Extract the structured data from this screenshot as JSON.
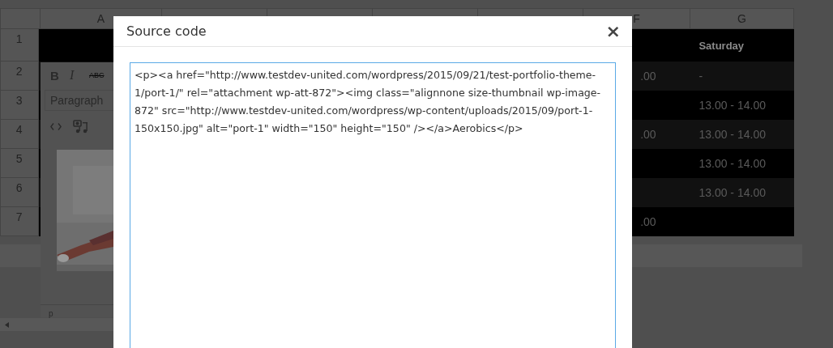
{
  "spreadsheet": {
    "column_headers": [
      "A",
      "F",
      "G"
    ],
    "row_numbers": [
      "1",
      "2",
      "3",
      "4",
      "5",
      "6",
      "7"
    ],
    "rows": [
      {
        "g": "Saturday",
        "kind": "header"
      },
      {
        "f": ".00",
        "g": "-",
        "kind": "data"
      },
      {
        "g": "13.00 - 14.00",
        "kind": "data"
      },
      {
        "f": ".00",
        "g": "13.00 - 14.00",
        "kind": "data"
      },
      {
        "g": "13.00 - 14.00",
        "kind": "data"
      },
      {
        "g": "13.00 - 14.00",
        "kind": "data"
      },
      {
        "f": ".00",
        "kind": "data"
      }
    ]
  },
  "editor": {
    "toolbar": [
      "B",
      "I",
      "ABC"
    ],
    "format_select": "Paragraph",
    "status_path": "p"
  },
  "dialog": {
    "title": "Source code",
    "close": "×",
    "code": "<p><a href=\"http://www.testdev-united.com/wordpress/2015/09/21/test-portfolio-theme-1/port-1/\" rel=\"attachment wp-att-872\"><img class=\"alignnone size-thumbnail wp-image-872\" src=\"http://www.testdev-united.com/wordpress/wp-content/uploads/2015/09/port-1-150x150.jpg\" alt=\"port-1\" width=\"150\" height=\"150\" /></a>Aerobics</p>"
  }
}
